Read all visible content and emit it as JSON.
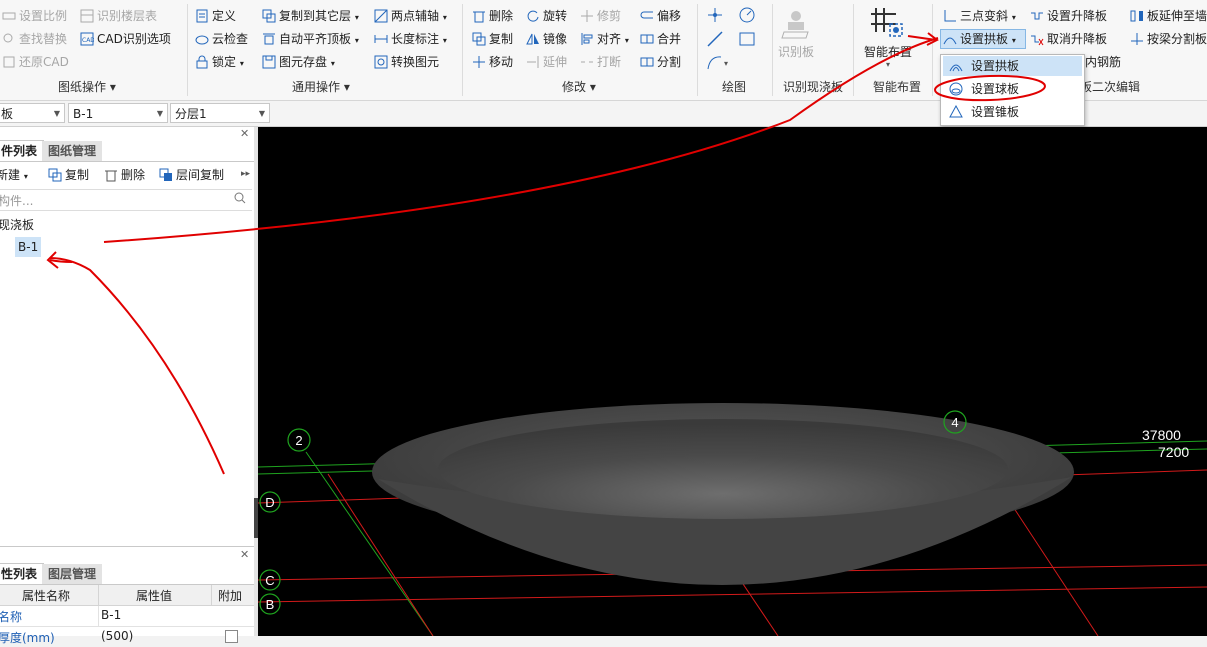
{
  "ribbon": {
    "drawing_ops": {
      "items": [
        "设置比例",
        "识别楼层表",
        "查找替换",
        "CAD识别选项",
        "还原CAD"
      ],
      "group_label": "图纸操作"
    },
    "general_ops": {
      "items": [
        "定义",
        "复制到其它层",
        "两点辅轴",
        "云检查",
        "自动平齐顶板",
        "长度标注",
        "锁定",
        "图元存盘",
        "转换图元"
      ],
      "group_label": "通用操作"
    },
    "modify": {
      "items": [
        "删除",
        "旋转",
        "修剪",
        "偏移",
        "复制",
        "镜像",
        "对齐",
        "合并",
        "移动",
        "延伸",
        "打断",
        "分割"
      ],
      "group_label": "修改"
    },
    "draw": {
      "group_label": "绘图"
    },
    "recognize": {
      "button_label": "识别板",
      "group_label": "识别现浇板"
    },
    "smart": {
      "button_label": "智能布置",
      "group_label": "智能布置"
    },
    "secondary": {
      "items": [
        "三点变斜",
        "设置升降板",
        "板延伸至墙",
        "设置拱板",
        "取消升降板",
        "按梁分割板",
        "内钢筋"
      ],
      "group_label": "板二次编辑"
    }
  },
  "dropdown": {
    "items": [
      "设置拱板",
      "设置球板",
      "设置锥板"
    ]
  },
  "toolbar": {
    "select1": "板",
    "select2": "B-1",
    "select3": "分层1"
  },
  "component_panel": {
    "tabs": [
      "件列表",
      "图纸管理"
    ],
    "actions": [
      "新建",
      "复制",
      "删除",
      "层间复制"
    ],
    "search_placeholder": "构件...",
    "category": "现浇板",
    "selected_item": "B-1"
  },
  "property_panel": {
    "tabs": [
      "性列表",
      "图层管理"
    ],
    "headers": [
      "属性名称",
      "属性值",
      "附加"
    ],
    "rows": [
      {
        "name": "名称",
        "value": "B-1"
      },
      {
        "name": "厚度(mm)",
        "value": "(500)"
      }
    ]
  },
  "viewport": {
    "axis_labels": [
      "2",
      "4",
      "D",
      "C",
      "B"
    ],
    "dimensions": [
      "37800",
      "7200"
    ]
  },
  "colors": {
    "annotation": "#e00000",
    "grid_red": "#d21a1a",
    "grid_green": "#1fa31f",
    "dropdown_highlight": "#cde3f7"
  }
}
